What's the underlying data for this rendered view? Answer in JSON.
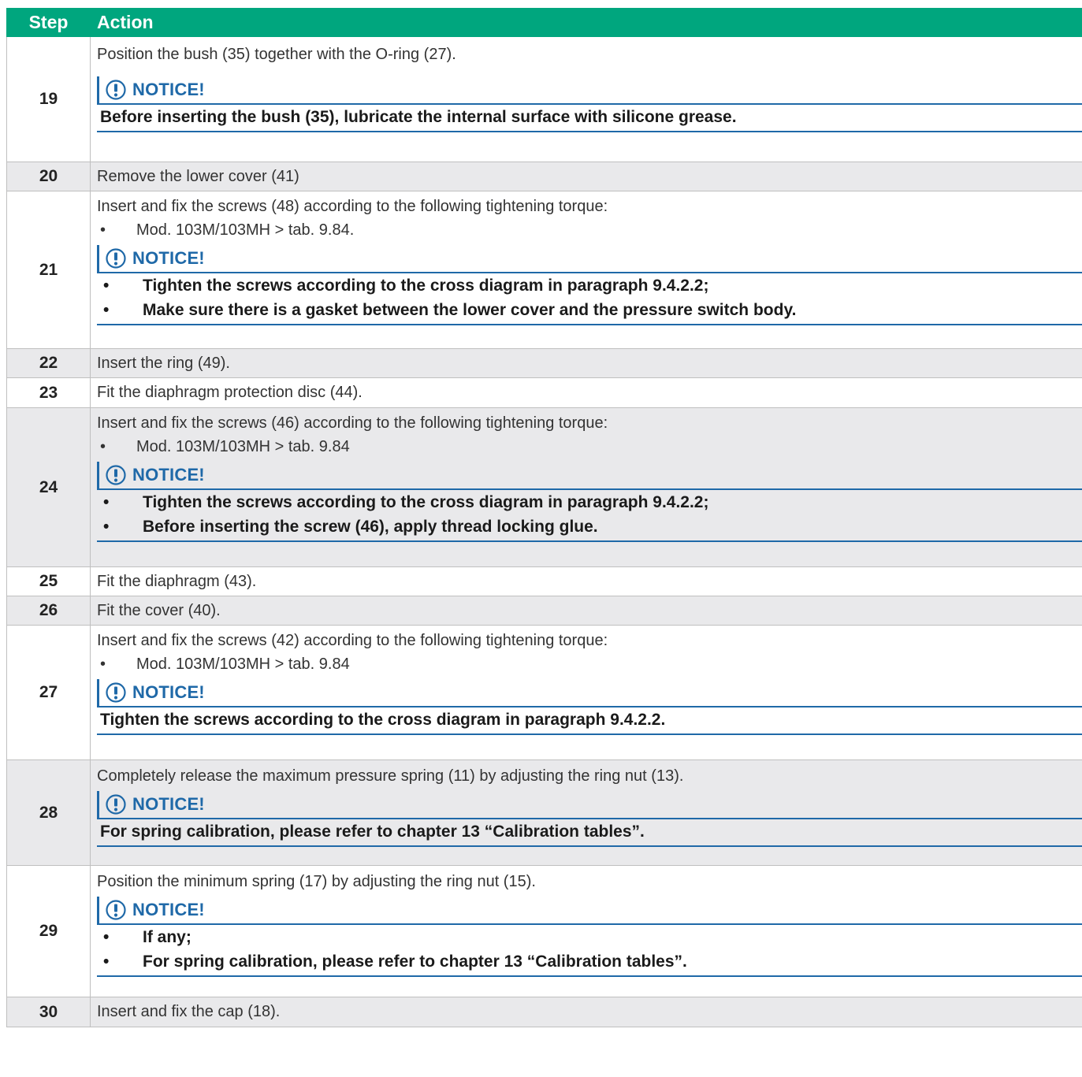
{
  "header": {
    "step": "Step",
    "action": "Action"
  },
  "notice_title": "NOTICE!",
  "rows": [
    {
      "step": "19",
      "lines": [
        "Position the bush (35) together with the O-ring (27)."
      ],
      "bullets": [],
      "notice_text": "Before inserting the bush (35), lubricate the internal surface with silicone grease.",
      "notice_bullets": []
    },
    {
      "step": "20",
      "simple": "Remove the lower cover (41)"
    },
    {
      "step": "21",
      "lines": [
        "Insert and fix the screws (48) according to the following tightening torque:"
      ],
      "bullets": [
        "Mod. 103M/103MH > tab. 9.84."
      ],
      "notice_bullets": [
        "Tighten the screws according to the cross diagram in paragraph 9.4.2.2;",
        "Make sure there is a gasket between the lower cover and the pressure switch body."
      ]
    },
    {
      "step": "22",
      "simple": "Insert the ring (49)."
    },
    {
      "step": "23",
      "simple": "Fit the diaphragm protection disc (44)."
    },
    {
      "step": "24",
      "lines": [
        "Insert and fix the screws (46) according to the following tightening torque:"
      ],
      "bullets": [
        "Mod. 103M/103MH > tab. 9.84"
      ],
      "notice_bullets": [
        "Tighten the screws according to the cross diagram in paragraph 9.4.2.2;",
        "Before inserting the screw (46), apply thread locking glue."
      ]
    },
    {
      "step": "25",
      "simple": "Fit the diaphragm (43)."
    },
    {
      "step": "26",
      "simple": "Fit the cover (40)."
    },
    {
      "step": "27",
      "lines": [
        "Insert and fix the screws (42) according to the following tightening torque:"
      ],
      "bullets": [
        "Mod. 103M/103MH > tab. 9.84"
      ],
      "notice_text": "Tighten the screws according to the cross diagram in paragraph 9.4.2.2."
    },
    {
      "step": "28",
      "lines": [
        "Completely release the maximum pressure spring (11) by adjusting the ring nut (13)."
      ],
      "bullets": [],
      "notice_text": "For spring calibration, please refer to chapter 13 “Calibration tables”."
    },
    {
      "step": "29",
      "lines": [
        "Position the minimum spring (17) by adjusting the ring nut (15)."
      ],
      "bullets": [],
      "notice_bullets": [
        "If any;",
        "For spring calibration, please refer to chapter 13 “Calibration tables”."
      ]
    },
    {
      "step": "30",
      "simple": "Insert and fix the cap (18)."
    }
  ]
}
